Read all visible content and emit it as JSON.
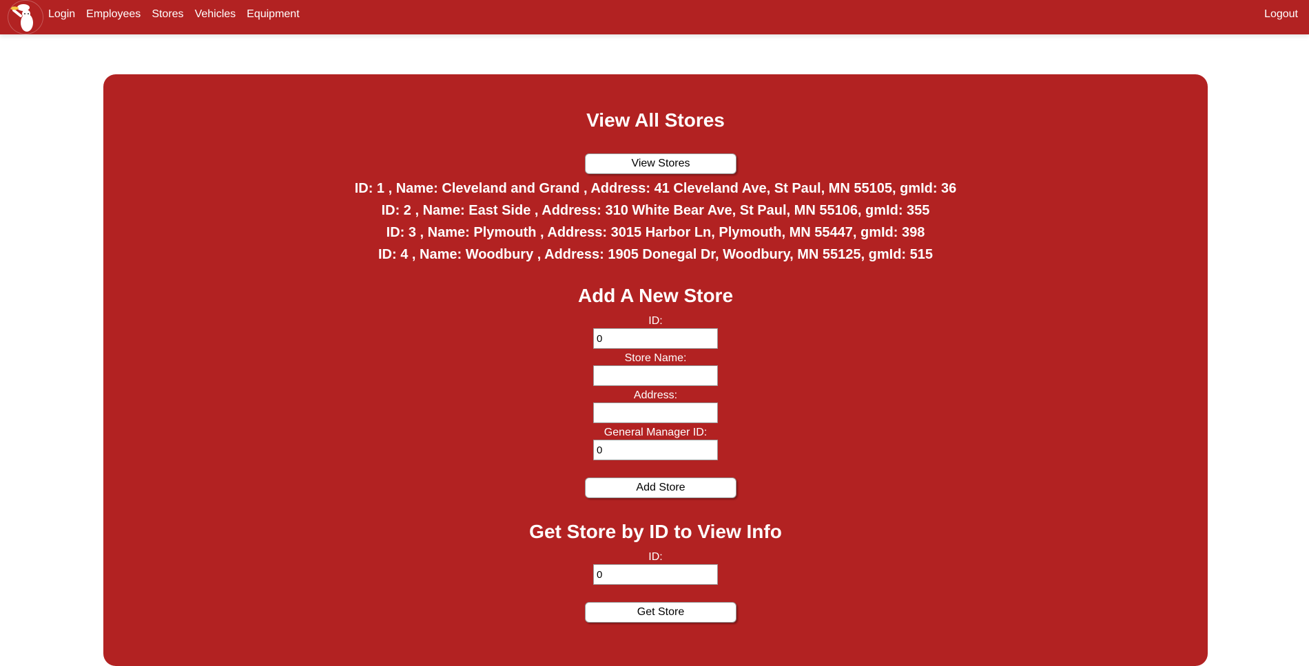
{
  "nav": {
    "logo": "pizza-chef-logo",
    "links": [
      "Login",
      "Employees",
      "Stores",
      "Vehicles",
      "Equipment"
    ],
    "logout": "Logout"
  },
  "view_section": {
    "title": "View All Stores",
    "button": "View Stores",
    "stores": [
      "ID: 1 , Name: Cleveland and Grand , Address: 41 Cleveland Ave, St Paul, MN 55105, gmId: 36",
      "ID: 2 , Name: East Side , Address: 310 White Bear Ave, St Paul, MN 55106, gmId: 355",
      "ID: 3 , Name: Plymouth , Address: 3015 Harbor Ln, Plymouth, MN 55447, gmId: 398",
      "ID: 4 , Name: Woodbury , Address: 1905 Donegal Dr, Woodbury, MN 55125, gmId: 515"
    ]
  },
  "add_section": {
    "title": "Add A New Store",
    "fields": [
      {
        "label": "ID:",
        "value": "0"
      },
      {
        "label": "Store Name:",
        "value": ""
      },
      {
        "label": "Address:",
        "value": ""
      },
      {
        "label": "General Manager ID:",
        "value": "0"
      }
    ],
    "button": "Add Store"
  },
  "get_section": {
    "title": "Get Store by ID to View Info",
    "id_label": "ID:",
    "id_value": "0",
    "button": "Get Store"
  },
  "colors": {
    "brand": "#b22222",
    "text": "#ffffff"
  }
}
